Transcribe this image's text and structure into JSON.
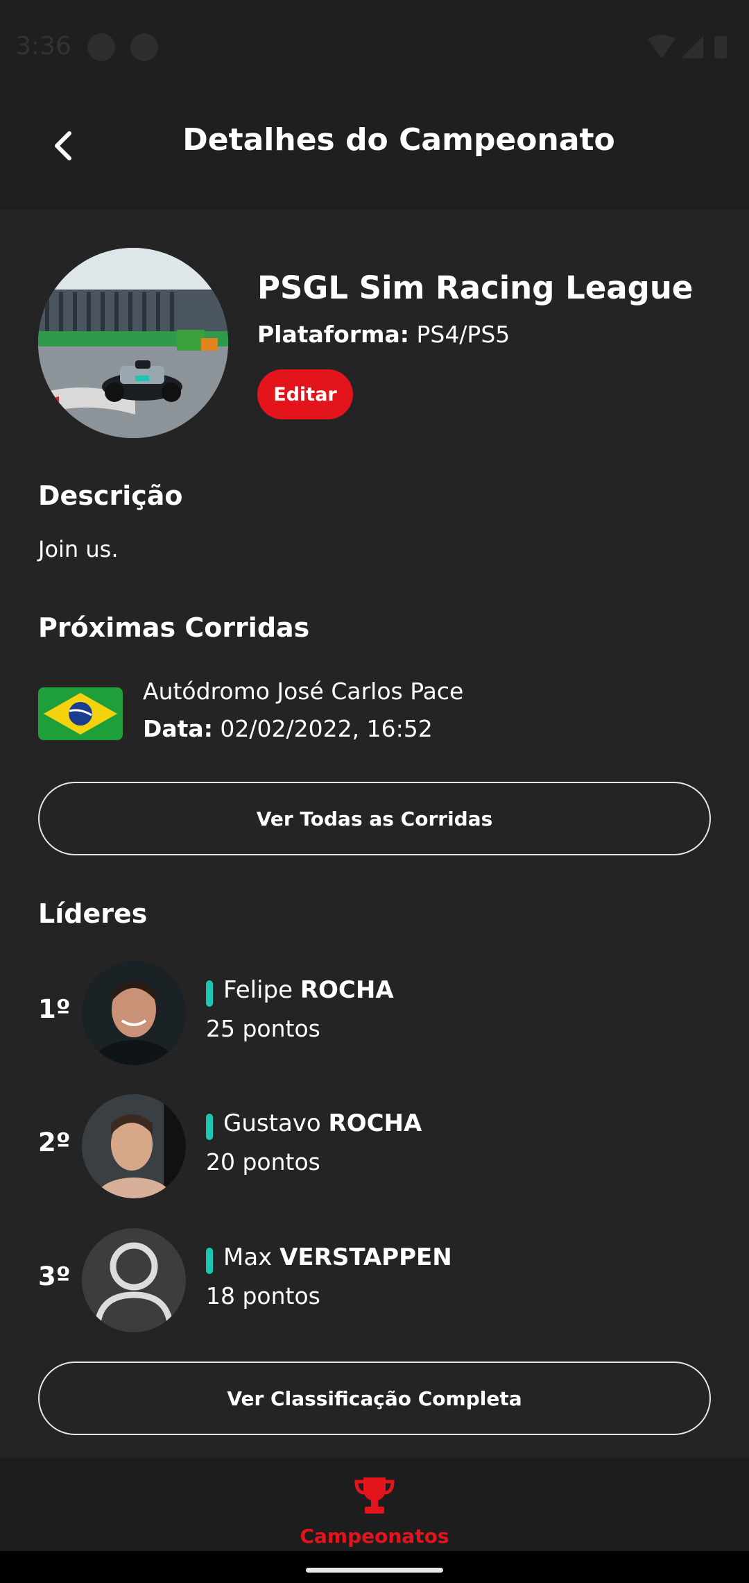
{
  "status_bar": {
    "time": "3:36"
  },
  "header": {
    "title": "Detalhes do Campeonato"
  },
  "league": {
    "name": "PSGL Sim Racing League",
    "platform_label": "Plataforma:",
    "platform_value": "PS4/PS5",
    "edit_label": "Editar"
  },
  "description": {
    "title": "Descrição",
    "text": "Join us."
  },
  "upcoming": {
    "title": "Próximas Corridas",
    "race": {
      "name": "Autódromo José Carlos Pace",
      "date_label": "Data:",
      "date_value": "02/02/2022, 16:52"
    },
    "all_races_label": "Ver Todas as Corridas"
  },
  "leaders": {
    "title": "Líderes",
    "items": [
      {
        "position": "1º",
        "first_name": "Felipe",
        "last_name": "ROCHA",
        "points": "25 pontos"
      },
      {
        "position": "2º",
        "first_name": "Gustavo",
        "last_name": "ROCHA",
        "points": "20 pontos"
      },
      {
        "position": "3º",
        "first_name": "Max",
        "last_name": "VERSTAPPEN",
        "points": "18 pontos"
      }
    ],
    "full_standings_label": "Ver Classificação Completa"
  },
  "bottom_nav": {
    "label": "Campeonatos"
  },
  "colors": {
    "accent": "#e3141c",
    "team": "#1cc6b5",
    "background": "#242424",
    "bar": "#1f1f1f"
  }
}
